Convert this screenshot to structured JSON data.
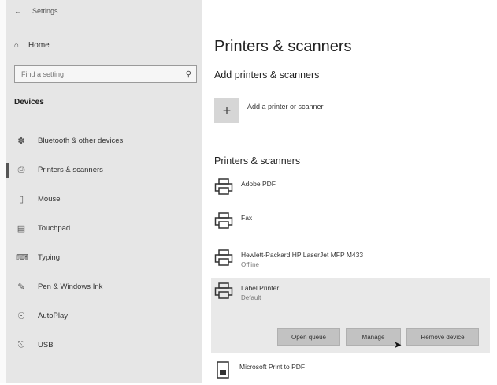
{
  "window": {
    "title": "Settings"
  },
  "sidebar": {
    "home_label": "Home",
    "search_placeholder": "Find a setting",
    "section": "Devices",
    "items": [
      {
        "label": "Bluetooth & other devices",
        "icon": "bluetooth-icon"
      },
      {
        "label": "Printers & scanners",
        "icon": "printer-icon",
        "active": true
      },
      {
        "label": "Mouse",
        "icon": "mouse-icon"
      },
      {
        "label": "Touchpad",
        "icon": "touchpad-icon"
      },
      {
        "label": "Typing",
        "icon": "keyboard-icon"
      },
      {
        "label": "Pen & Windows Ink",
        "icon": "pen-icon"
      },
      {
        "label": "AutoPlay",
        "icon": "autoplay-icon"
      },
      {
        "label": "USB",
        "icon": "usb-icon"
      }
    ]
  },
  "main": {
    "title": "Printers & scanners",
    "add_heading": "Add printers & scanners",
    "add_label": "Add a printer or scanner",
    "list_heading": "Printers & scanners",
    "printers": [
      {
        "name": "Adobe PDF",
        "status": ""
      },
      {
        "name": "Fax",
        "status": ""
      },
      {
        "name": "Hewlett-Packard HP LaserJet MFP M433",
        "status": "Offline"
      },
      {
        "name": "Label Printer",
        "status": "Default",
        "selected": true
      },
      {
        "name": "Microsoft Print to PDF",
        "status": ""
      }
    ],
    "actions": {
      "open_queue": "Open queue",
      "manage": "Manage",
      "remove": "Remove device"
    }
  }
}
